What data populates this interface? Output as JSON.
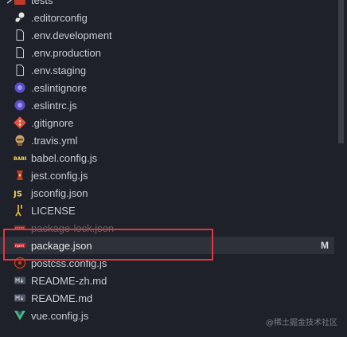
{
  "explorer": {
    "folder_label": "tests",
    "items": [
      {
        "label": ".editorconfig",
        "icon": "editorconfig-icon"
      },
      {
        "label": ".env.development",
        "icon": "file-icon"
      },
      {
        "label": ".env.production",
        "icon": "file-icon"
      },
      {
        "label": ".env.staging",
        "icon": "file-icon"
      },
      {
        "label": ".eslintignore",
        "icon": "eslint-icon"
      },
      {
        "label": ".eslintrc.js",
        "icon": "eslint-icon"
      },
      {
        "label": ".gitignore",
        "icon": "git-icon"
      },
      {
        "label": ".travis.yml",
        "icon": "travis-icon"
      },
      {
        "label": "babel.config.js",
        "icon": "babel-icon"
      },
      {
        "label": "jest.config.js",
        "icon": "jest-icon"
      },
      {
        "label": "jsconfig.json",
        "icon": "js-icon"
      },
      {
        "label": "LICENSE",
        "icon": "license-icon"
      },
      {
        "label": "package-lock.json",
        "icon": "npm-icon"
      },
      {
        "label": "package.json",
        "icon": "npm-icon",
        "badge": "M"
      },
      {
        "label": "postcss.config.js",
        "icon": "postcss-icon"
      },
      {
        "label": "README-zh.md",
        "icon": "markdown-icon"
      },
      {
        "label": "README.md",
        "icon": "markdown-icon"
      },
      {
        "label": "vue.config.js",
        "icon": "vue-icon"
      }
    ]
  },
  "watermark": "@稀土掘金技术社区",
  "colors": {
    "background": "#1e2129",
    "selected_row": "#2c313a",
    "highlight_box": "#e2373f",
    "text": "#c8ccd4"
  }
}
